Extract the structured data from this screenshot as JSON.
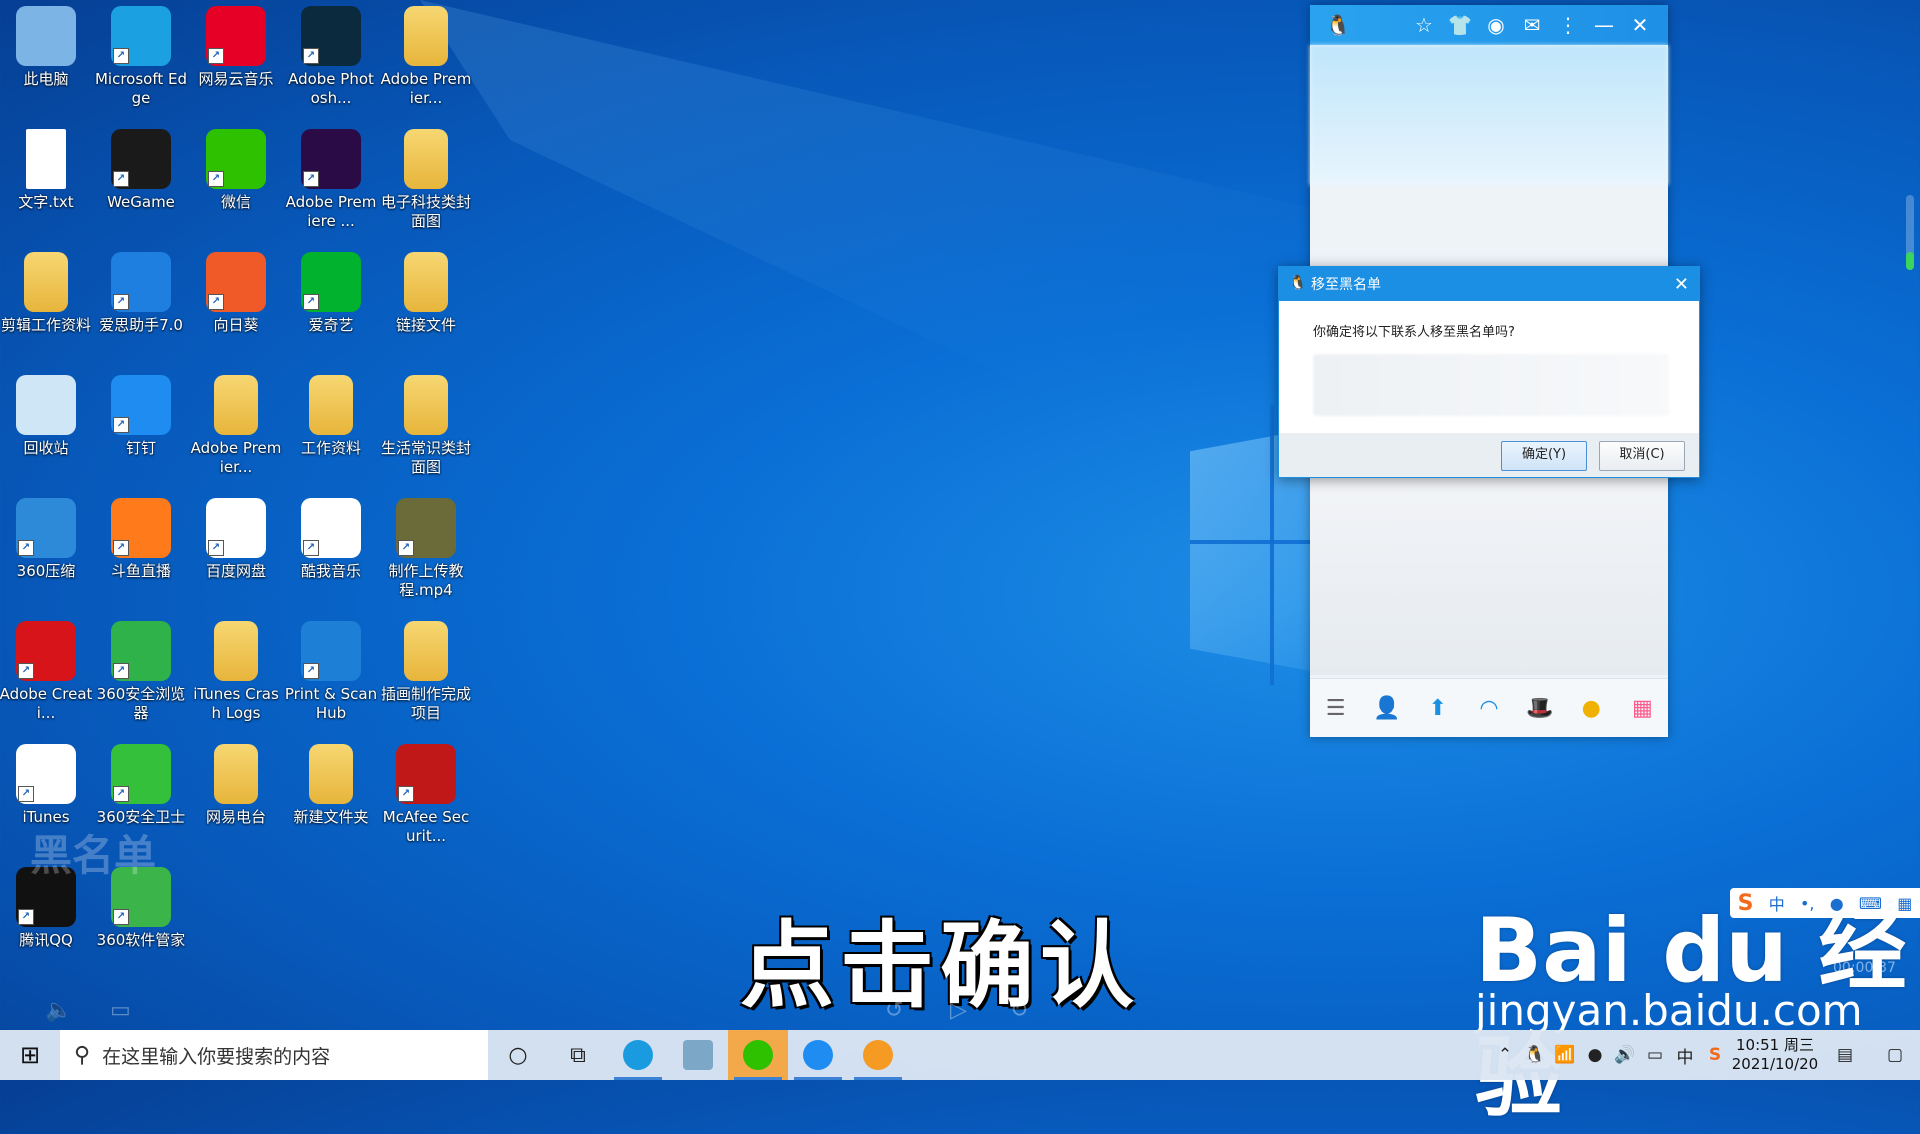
{
  "desktop": {
    "icons": [
      {
        "label": "此电脑",
        "icon": "computer-icon",
        "color": "#7db4e6"
      },
      {
        "label": "Microsoft Edge",
        "icon": "edge-icon",
        "color": "#1ba1e2"
      },
      {
        "label": "网易云音乐",
        "icon": "netease-music-icon",
        "color": "#e60026"
      },
      {
        "label": "Adobe Photosh...",
        "icon": "photoshop-icon",
        "color": "#0b2a3d"
      },
      {
        "label": "Adobe Premier...",
        "icon": "folder-icon",
        "color": "#e9b93f"
      },
      {
        "label": "文字.txt",
        "icon": "text-file-icon",
        "color": "#ffffff"
      },
      {
        "label": "WeGame",
        "icon": "wegame-icon",
        "color": "#1a1a1a"
      },
      {
        "label": "微信",
        "icon": "wechat-icon",
        "color": "#2dc100"
      },
      {
        "label": "Adobe Premiere ...",
        "icon": "premiere-icon",
        "color": "#2a0b45"
      },
      {
        "label": "电子科技类封面图",
        "icon": "folder-icon",
        "color": "#e9b93f"
      },
      {
        "label": "剪辑工作资料",
        "icon": "folder-icon",
        "color": "#e9b93f"
      },
      {
        "label": "爱思助手7.0",
        "icon": "i4-icon",
        "color": "#1e7fe0"
      },
      {
        "label": "向日葵",
        "icon": "sunflower-icon",
        "color": "#f05a28"
      },
      {
        "label": "爱奇艺",
        "icon": "iqiyi-icon",
        "color": "#00b22d"
      },
      {
        "label": "链接文件",
        "icon": "folder-icon",
        "color": "#e9b93f"
      },
      {
        "label": "回收站",
        "icon": "recycle-bin-icon",
        "color": "#cfe6f7"
      },
      {
        "label": "钉钉",
        "icon": "dingtalk-icon",
        "color": "#1e8cf0"
      },
      {
        "label": "Adobe Premier...",
        "icon": "folder-icon",
        "color": "#e9b93f"
      },
      {
        "label": "工作资料",
        "icon": "folder-icon",
        "color": "#e9b93f"
      },
      {
        "label": "生活常识类封面图",
        "icon": "folder-icon",
        "color": "#e9b93f"
      },
      {
        "label": "360压缩",
        "icon": "360-zip-icon",
        "color": "#2d8ad8"
      },
      {
        "label": "斗鱼直播",
        "icon": "douyu-icon",
        "color": "#ff7a1a"
      },
      {
        "label": "百度网盘",
        "icon": "baidu-netdisk-icon",
        "color": "#ffffff"
      },
      {
        "label": "酷我音乐",
        "icon": "kuwo-icon",
        "color": "#ffffff"
      },
      {
        "label": "制作上传教程.mp4",
        "icon": "video-file-icon",
        "color": "#6b6b3a"
      },
      {
        "label": "Adobe Creati...",
        "icon": "creative-cloud-icon",
        "color": "#d7141a"
      },
      {
        "label": "360安全浏览器",
        "icon": "360-browser-icon",
        "color": "#2fb24a"
      },
      {
        "label": "iTunes Crash Logs",
        "icon": "folder-icon",
        "color": "#e9b93f"
      },
      {
        "label": "Print & Scan Hub",
        "icon": "print-scan-icon",
        "color": "#1e7fd6"
      },
      {
        "label": "插画制作完成项目",
        "icon": "folder-icon",
        "color": "#e9b93f"
      },
      {
        "label": "iTunes",
        "icon": "itunes-icon",
        "color": "#ffffff"
      },
      {
        "label": "360安全卫士",
        "icon": "360-safe-icon",
        "color": "#34c03a"
      },
      {
        "label": "网易电台",
        "icon": "folder-icon",
        "color": "#e9b93f"
      },
      {
        "label": "新建文件夹",
        "icon": "folder-icon",
        "color": "#e9b93f"
      },
      {
        "label": "McAfee Securit...",
        "icon": "mcafee-icon",
        "color": "#c01818"
      },
      {
        "label": "腾讯QQ",
        "icon": "qq-icon",
        "color": "#111111"
      },
      {
        "label": "360软件管家",
        "icon": "360-software-icon",
        "color": "#3bb54a"
      }
    ]
  },
  "qq": {
    "title_icons": [
      "qq-penguin-icon",
      "star-icon",
      "shirt-icon",
      "skin-icon",
      "mail-icon",
      "menu-dots-icon",
      "minimize-icon",
      "close-icon"
    ],
    "bottom_icons": [
      "menu-icon",
      "add-contact-icon",
      "share-icon",
      "qzone-icon",
      "game-icon",
      "weiyun-icon",
      "apps-icon"
    ]
  },
  "dialog": {
    "title": "移至黑名单",
    "message": "你确定将以下联系人移至黑名单吗?",
    "confirm_label": "确定(Y)",
    "cancel_label": "取消(C)"
  },
  "overlay": {
    "caption": "点击确认",
    "faint_label": "黑名单",
    "baidu_logo": "Bai du 经验",
    "baidu_url": "jingyan.baidu.com",
    "video_time": "00:00:37"
  },
  "ime": {
    "brand": "S",
    "mode": "中",
    "items": [
      "中",
      "•,",
      "🎤",
      "⌨",
      "▦"
    ]
  },
  "taskbar": {
    "search_placeholder": "在这里输入你要搜索的内容",
    "apps": [
      {
        "name": "edge",
        "color": "#1a9be0",
        "active": false
      },
      {
        "name": "explorer-file",
        "color": "#7da7c7",
        "active": false
      },
      {
        "name": "wechat",
        "color": "#2dc100",
        "active": true
      },
      {
        "name": "dingtalk",
        "color": "#1e8cf0",
        "active": false
      },
      {
        "name": "app-orange",
        "color": "#f59a23",
        "active": false
      }
    ],
    "clock_time": "10:51 周三",
    "clock_date": "2021/10/20"
  },
  "colors": {
    "desktop_bg": "#0a6fd6",
    "qq_title": "#1e90e6",
    "dialog_title": "#1b8fe3"
  }
}
